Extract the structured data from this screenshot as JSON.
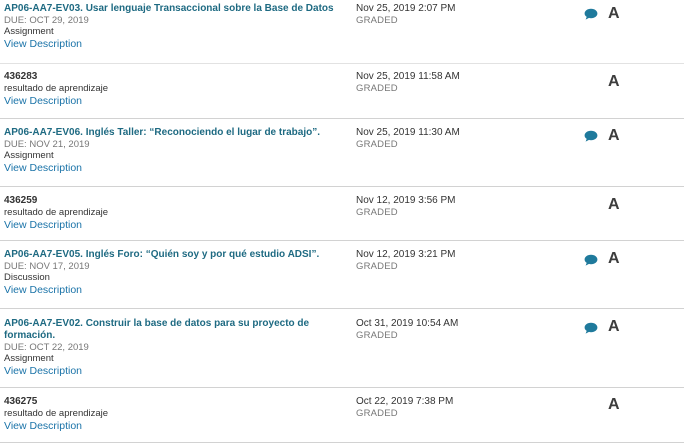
{
  "rows": [
    {
      "title": "AP06-AA7-EV03. Usar lenguaje Transaccional sobre la Base de Datos",
      "due": "DUE: OCT 29, 2019",
      "type": "Assignment",
      "link": "View Description",
      "date": "Nov 25, 2019 2:07 PM",
      "status": "GRADED",
      "grade": "A",
      "has_comment": true
    },
    {
      "title": "436283",
      "due": "",
      "type": "resultado de aprendizaje",
      "link": "View Description",
      "date": "Nov 25, 2019 11:58 AM",
      "status": "GRADED",
      "grade": "A",
      "has_comment": false
    },
    {
      "title": "AP06-AA7-EV06. Inglés Taller: “Reconociendo el lugar de trabajo”.",
      "due": "DUE: NOV 21, 2019",
      "type": "Assignment",
      "link": "View Description",
      "date": "Nov 25, 2019 11:30 AM",
      "status": "GRADED",
      "grade": "A",
      "has_comment": true
    },
    {
      "title": "436259",
      "due": "",
      "type": "resultado de aprendizaje",
      "link": "View Description",
      "date": "Nov 12, 2019 3:56 PM",
      "status": "GRADED",
      "grade": "A",
      "has_comment": false
    },
    {
      "title": "AP06-AA7-EV05. Inglés Foro: “Quién soy y por qué estudio ADSI”.",
      "due": "DUE: NOV 17, 2019",
      "type": "Discussion",
      "link": "View Description",
      "date": "Nov 12, 2019 3:21 PM",
      "status": "GRADED",
      "grade": "A",
      "has_comment": true
    },
    {
      "title": "AP06-AA7-EV02. Construir la base de datos para su proyecto de formación.",
      "due": "DUE: OCT 22, 2019",
      "type": "Assignment",
      "link": "View Description",
      "date": "Oct 31, 2019 10:54 AM",
      "status": "GRADED",
      "grade": "A",
      "has_comment": true
    },
    {
      "title": "436275",
      "due": "",
      "type": "resultado de aprendizaje",
      "link": "View Description",
      "date": "Oct 22, 2019 7:38 PM",
      "status": "GRADED",
      "grade": "A",
      "has_comment": false
    }
  ],
  "colors": {
    "title_link": "#1e6a82",
    "view_link": "#1a73a8",
    "comment_icon": "#1f7a9c",
    "separator": "#d2d2d2"
  }
}
